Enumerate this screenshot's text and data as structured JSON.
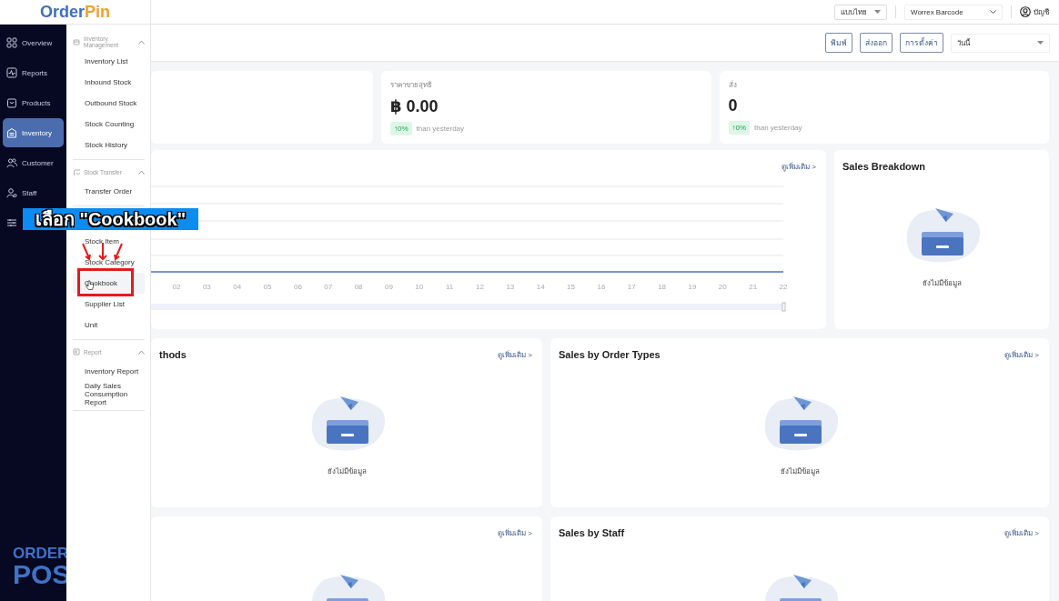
{
  "logo": {
    "word": "Order",
    "accent": "Pin"
  },
  "nav": [
    {
      "label": "Overview",
      "selected": false
    },
    {
      "label": "Reports",
      "selected": false
    },
    {
      "label": "Products",
      "selected": false
    },
    {
      "label": "Inventory",
      "selected": true
    },
    {
      "label": "Customer",
      "selected": false
    },
    {
      "label": "Staff",
      "selected": false
    },
    {
      "selected": false
    }
  ],
  "footer_logo": {
    "top": "ORDER",
    "bottom": "POS"
  },
  "submenu": {
    "groups": [
      {
        "title": "Inventory Management",
        "expanded": true,
        "items": [
          {
            "label": "Inventory List",
            "selected": false
          },
          {
            "label": "Inbound Stock",
            "selected": false
          },
          {
            "label": "Outbound Stock",
            "selected": false
          },
          {
            "label": "Stock Counting",
            "selected": false
          },
          {
            "label": "Stock History",
            "selected": false
          }
        ]
      },
      {
        "title": "Stock Transfer",
        "expanded": true,
        "items": [
          {
            "label": "Transfer Order",
            "selected": false
          }
        ]
      },
      {
        "items": [
          {
            "label": "Stock Item",
            "selected": false
          },
          {
            "label": "Stock Category",
            "selected": false
          },
          {
            "label": "Cookbook",
            "selected": true
          },
          {
            "label": "Supplier List",
            "selected": false
          },
          {
            "label": "Unit",
            "selected": false
          }
        ]
      },
      {
        "title": "Report",
        "expanded": true,
        "items": [
          {
            "label": "Inventory Report",
            "selected": false
          },
          {
            "label": "Daily Sales Consumption Report",
            "selected": false
          }
        ]
      }
    ]
  },
  "topbar": {
    "language": "แบบไทย",
    "store": "Worrex Barcode",
    "account": "บัญชี"
  },
  "toolbar": {
    "buttons": [
      "พิมพ์",
      "ส่งออก",
      "การตั้งค่า"
    ],
    "period": "วันนี้"
  },
  "stats": [
    {
      "kind": "blank"
    },
    {
      "kind": "metric",
      "label": "ราคาขายสุทธิ",
      "value": "฿ 0.00",
      "change": "↑0%",
      "note": "than yesterday"
    },
    {
      "kind": "metric",
      "label": "สั่ง",
      "value": "0",
      "change": "↑0%",
      "note": "than yesterday"
    }
  ],
  "sales_chart": {
    "link": "ดูเพิ่มเติม >",
    "x_labels": [
      "02",
      "03",
      "04",
      "05",
      "06",
      "07",
      "08",
      "09",
      "10",
      "11",
      "12",
      "13",
      "14",
      "15",
      "16",
      "17",
      "18",
      "19",
      "20",
      "21",
      "22"
    ]
  },
  "breakdown": {
    "title": "Sales Breakdown",
    "empty_text": "ยังไม่มีข้อมูล"
  },
  "panel_rows": [
    [
      {
        "title": "thods",
        "link": "ดูเพิ่มเติม >",
        "empty_text": "ยังไม่มีข้อมูล"
      },
      {
        "title": "Sales by Order Types",
        "link": "ดูเพิ่มเติม >",
        "empty_text": "ยังไม่มีข้อมูล"
      }
    ],
    [
      {
        "link": "ดูเพิ่มเติม >"
      },
      {
        "title": "Sales by Staff",
        "link": "ดูเพิ่มเติม >"
      }
    ]
  ],
  "caption": {
    "text": "เลือก \"Cookbook\""
  }
}
